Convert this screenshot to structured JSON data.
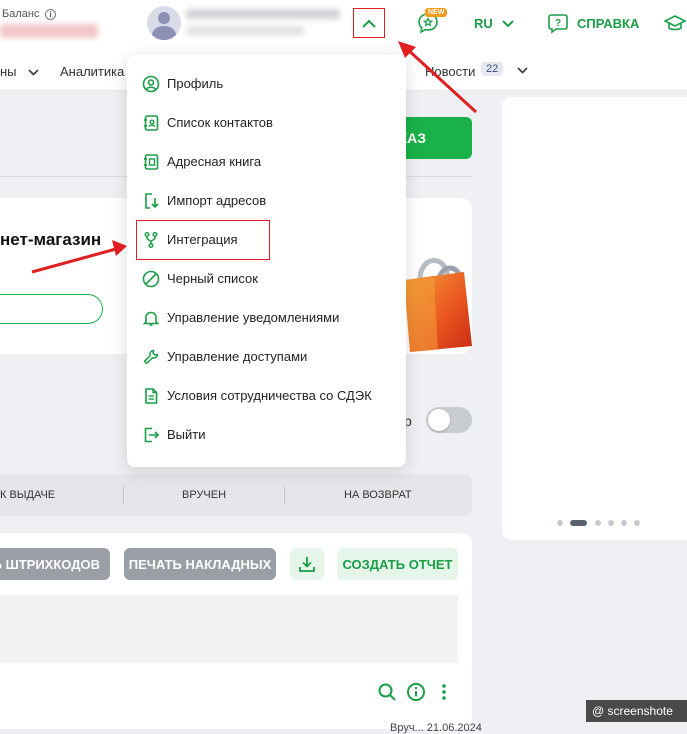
{
  "header": {
    "balance_label": "Баланс",
    "info_glyph": "i",
    "new_badge": "NEW",
    "language": "RU",
    "help_label": "СПРАВКА"
  },
  "nav": {
    "items": [
      "ны",
      "Аналитика",
      "Новости"
    ],
    "news_count": "22"
  },
  "content": {
    "order_button": "КАЗ",
    "promo_title": "нет-магазин",
    "toggle_label": "р",
    "tabs": [
      "К ВЫДАЧЕ",
      "ВРУЧЕН",
      "НА ВОЗВРАТ"
    ],
    "buttons": {
      "barcodes": "ТЬ ШТРИХКОДОВ",
      "waybills": "ПЕЧАТЬ НАКЛАДНЫХ",
      "report": "СОЗДАТЬ ОТЧЕТ"
    },
    "bottom_date": "Вруч... 21.06.2024"
  },
  "menu": {
    "items": [
      {
        "label": "Профиль",
        "icon": "user-circle-icon"
      },
      {
        "label": "Список контактов",
        "icon": "contact-book-icon"
      },
      {
        "label": "Адресная книга",
        "icon": "address-book-icon"
      },
      {
        "label": "Импорт адресов",
        "icon": "import-icon"
      },
      {
        "label": "Интеграция",
        "icon": "integration-branch-icon"
      },
      {
        "label": "Черный список",
        "icon": "blocked-icon"
      },
      {
        "label": "Управление уведомлениями",
        "icon": "bell-icon"
      },
      {
        "label": "Управление доступами",
        "icon": "wrench-icon"
      },
      {
        "label": "Условия сотрудничества со СДЭК",
        "icon": "document-icon"
      },
      {
        "label": "Выйти",
        "icon": "logout-icon"
      }
    ]
  },
  "carousel": {
    "slides": 6,
    "active_slide": 2
  },
  "watermark": "@ screenshote",
  "colors": {
    "accent": "#1ab248",
    "accent_text": "#1a9e48",
    "annotation": "#e02020",
    "badge": "#f59b1b"
  }
}
